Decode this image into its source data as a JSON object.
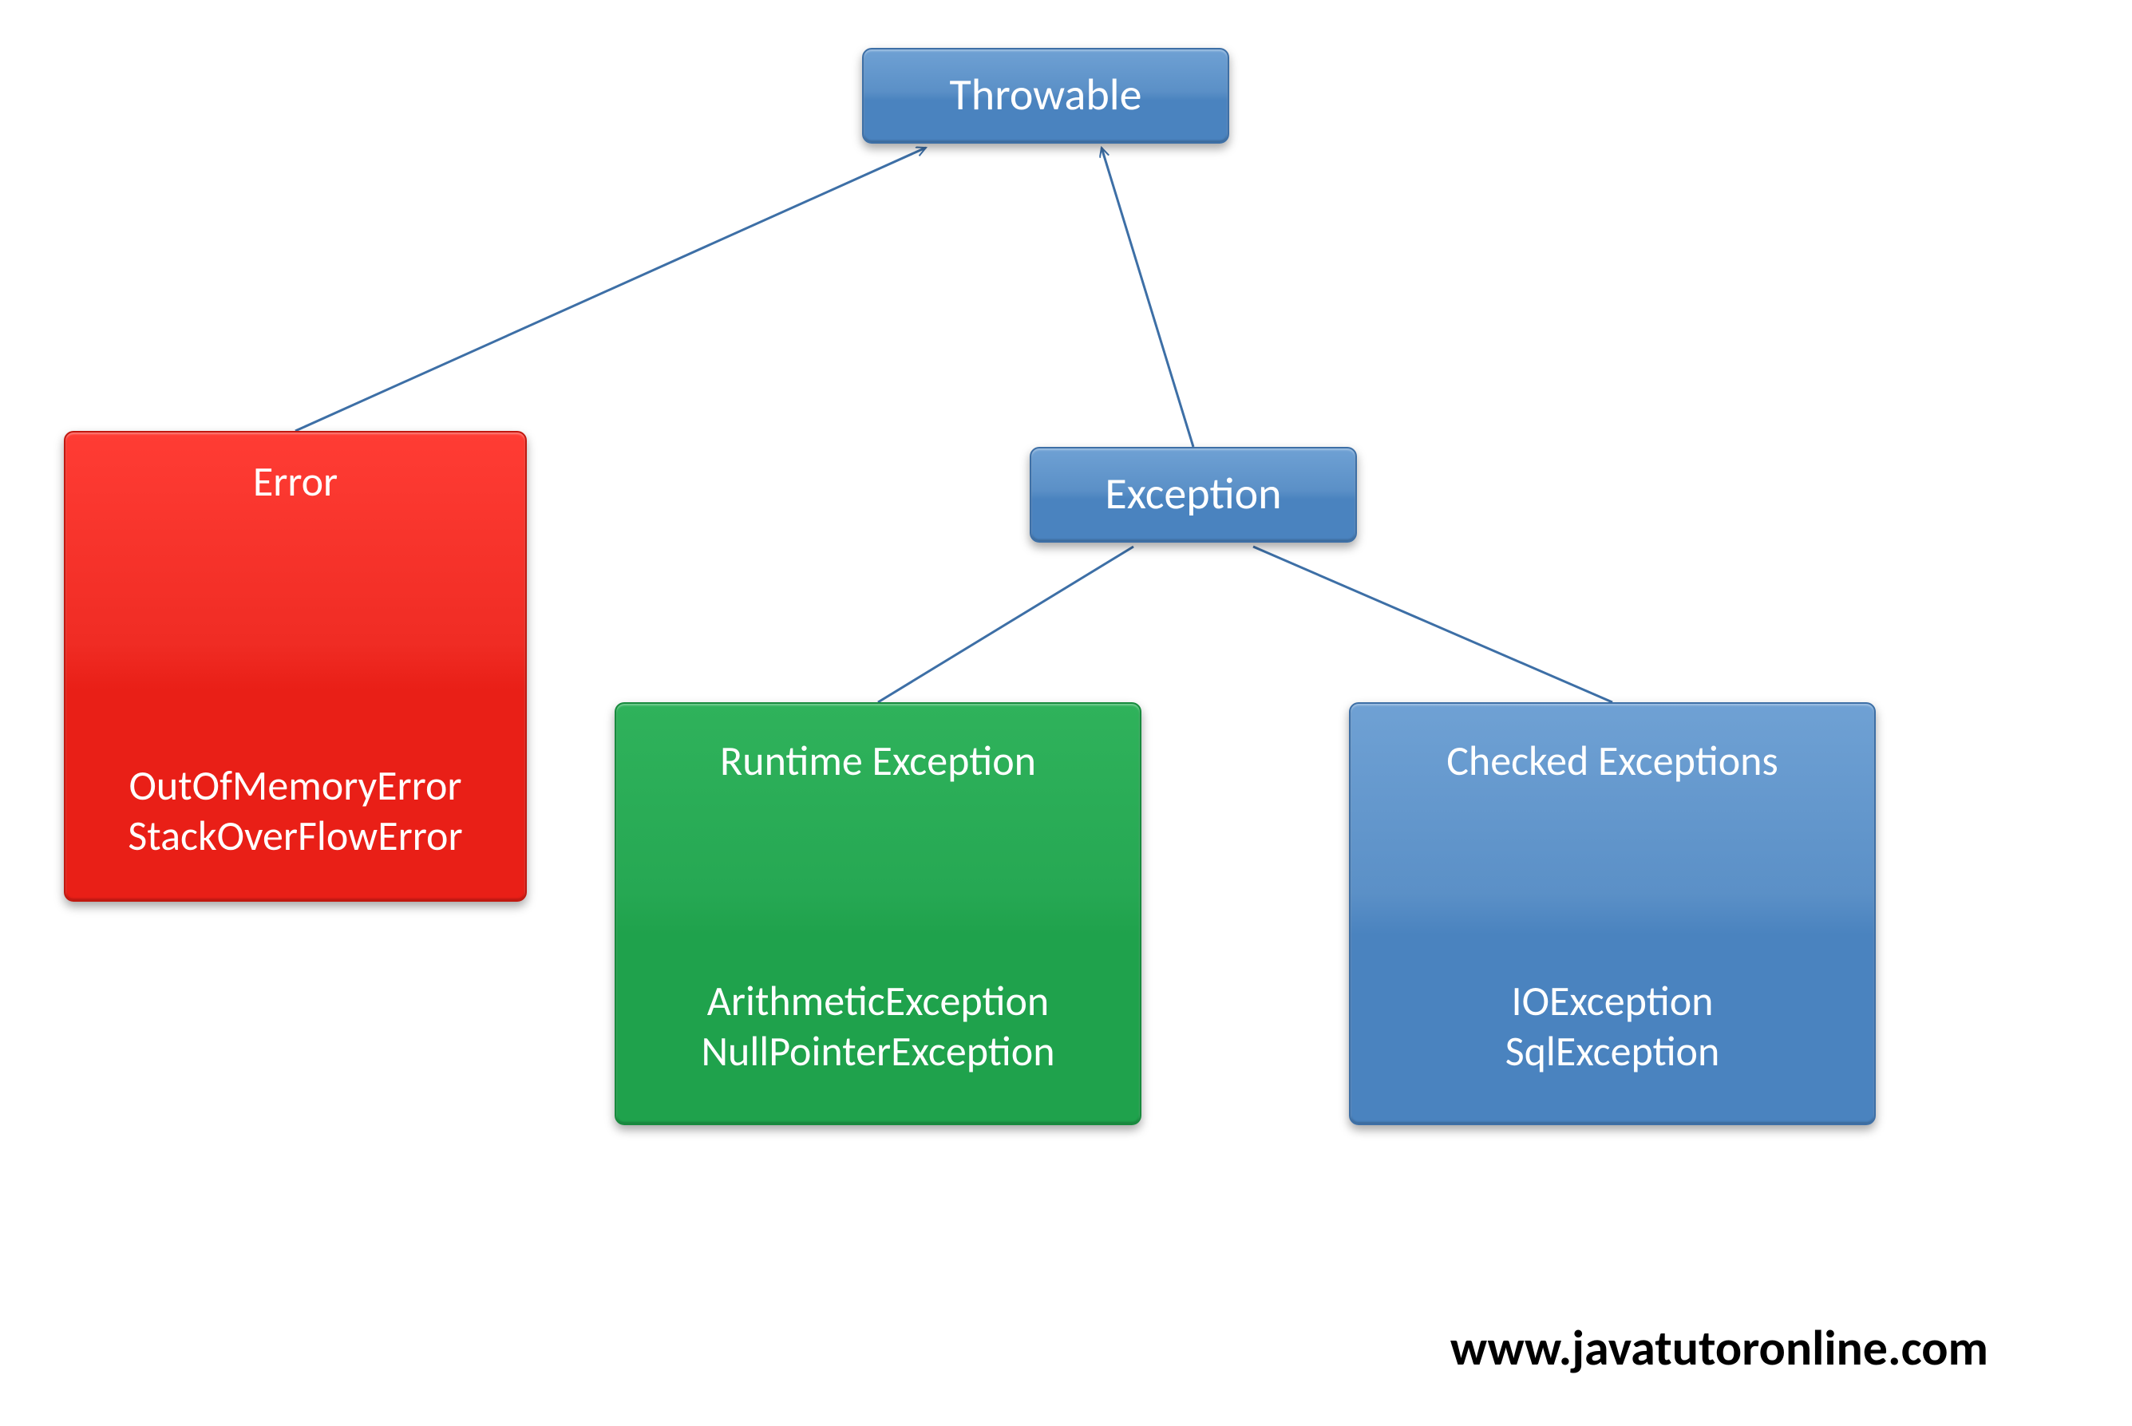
{
  "nodes": {
    "throwable": {
      "title": "Throwable"
    },
    "error": {
      "title": "Error",
      "examples": [
        "OutOfMemoryError",
        "StackOverFlowError"
      ]
    },
    "exception": {
      "title": "Exception"
    },
    "runtime": {
      "title": "Runtime Exception",
      "examples": [
        "ArithmeticException",
        "NullPointerException"
      ]
    },
    "checked": {
      "title": "Checked Exceptions",
      "examples": [
        "IOException",
        "SqlException"
      ]
    }
  },
  "footer": {
    "url": "www.javatutoronline.com"
  },
  "colors": {
    "blue": "#4a83bf",
    "red": "#e91f17",
    "green": "#1fa24c",
    "connector": "#3d6fa6"
  }
}
